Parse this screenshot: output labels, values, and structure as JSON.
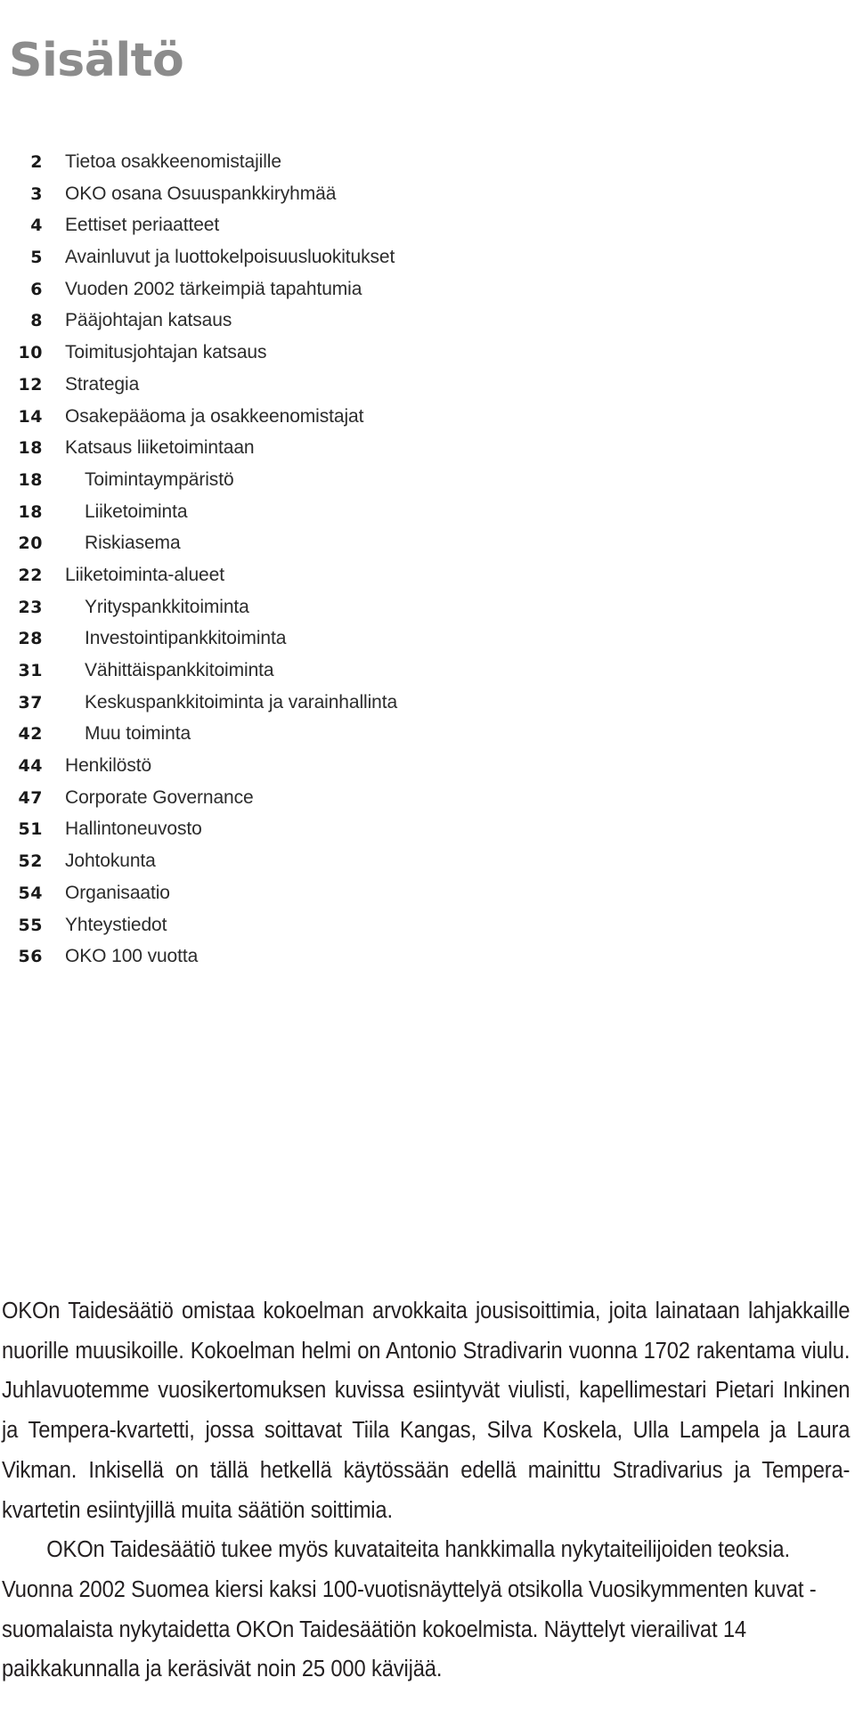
{
  "document": {
    "title": "Sisältö"
  },
  "toc": {
    "entries": [
      {
        "page": "2",
        "label": "Tietoa osakkeenomistajille",
        "indent": false
      },
      {
        "page": "3",
        "label": "OKO osana Osuuspankkiryhmää",
        "indent": false
      },
      {
        "page": "4",
        "label": "Eettiset periaatteet",
        "indent": false
      },
      {
        "page": "5",
        "label": "Avainluvut ja luottokelpoisuusluokitukset",
        "indent": false
      },
      {
        "page": "6",
        "label": "Vuoden 2002 tärkeimpiä tapahtumia",
        "indent": false
      },
      {
        "page": "8",
        "label": "Pääjohtajan katsaus",
        "indent": false
      },
      {
        "page": "10",
        "label": "Toimitusjohtajan katsaus",
        "indent": false
      },
      {
        "page": "12",
        "label": "Strategia",
        "indent": false
      },
      {
        "page": "14",
        "label": "Osakepääoma ja osakkeenomistajat",
        "indent": false
      },
      {
        "page": "18",
        "label": "Katsaus liiketoimintaan",
        "indent": false
      },
      {
        "page": "18",
        "label": "Toimintaympäristö",
        "indent": true
      },
      {
        "page": "18",
        "label": "Liiketoiminta",
        "indent": true
      },
      {
        "page": "20",
        "label": "Riskiasema",
        "indent": true
      },
      {
        "page": "22",
        "label": "Liiketoiminta-alueet",
        "indent": false
      },
      {
        "page": "23",
        "label": "Yrityspankkitoiminta",
        "indent": true
      },
      {
        "page": "28",
        "label": "Investointipankkitoiminta",
        "indent": true
      },
      {
        "page": "31",
        "label": "Vähittäispankkitoiminta",
        "indent": true
      },
      {
        "page": "37",
        "label": "Keskuspankkitoiminta ja varainhallinta",
        "indent": true
      },
      {
        "page": "42",
        "label": "Muu toiminta",
        "indent": true
      },
      {
        "page": "44",
        "label": "Henkilöstö",
        "indent": false
      },
      {
        "page": "47",
        "label": "Corporate Governance",
        "indent": false
      },
      {
        "page": "51",
        "label": "Hallintoneuvosto",
        "indent": false
      },
      {
        "page": "52",
        "label": "Johtokunta",
        "indent": false
      },
      {
        "page": "54",
        "label": "Organisaatio",
        "indent": false
      },
      {
        "page": "55",
        "label": "Yhteystiedot",
        "indent": false
      },
      {
        "page": "56",
        "label": "OKO 100 vuotta",
        "indent": false
      }
    ]
  },
  "body": {
    "paragraphs": [
      {
        "indented": false,
        "text": "OKOn Taidesäätiö omistaa kokoelman arvokkaita jousisoittimia, joita lainataan lahjakkaille nuorille muusikoille. Kokoelman helmi on Antonio Stradivarin vuonna 1702 rakentama viulu. Juhlavuotemme vuosikertomuksen kuvissa esiintyvät viulisti, kapellimestari Pietari Inkinen ja Tempera-kvartetti, jossa soittavat Tiila Kangas, Silva Koskela, Ulla Lampela ja Laura Vikman. Inkisellä on tällä hetkellä käytössään edellä mainittu Stradivarius ja Tempera-kvartetin esiintyjillä muita säätiön soittimia."
      },
      {
        "indented": true,
        "text": "OKOn Taidesäätiö tukee myös kuvataiteita hankkimalla nykytaiteilijoiden teoksia. Vuonna 2002 Suomea kiersi kaksi 100-vuotisnäyttelyä otsikolla Vuosikymmenten kuvat - suomalaista nykytaidetta OKOn Taidesäätiön kokoelmista. Näyttelyt vierailivat 14 paikkakunnalla ja keräsivät noin 25 000 kävijää."
      }
    ]
  },
  "colors": {
    "title_gray": "#8c8c8c",
    "text_black": "#231f20",
    "page_background": "#ffffff"
  }
}
